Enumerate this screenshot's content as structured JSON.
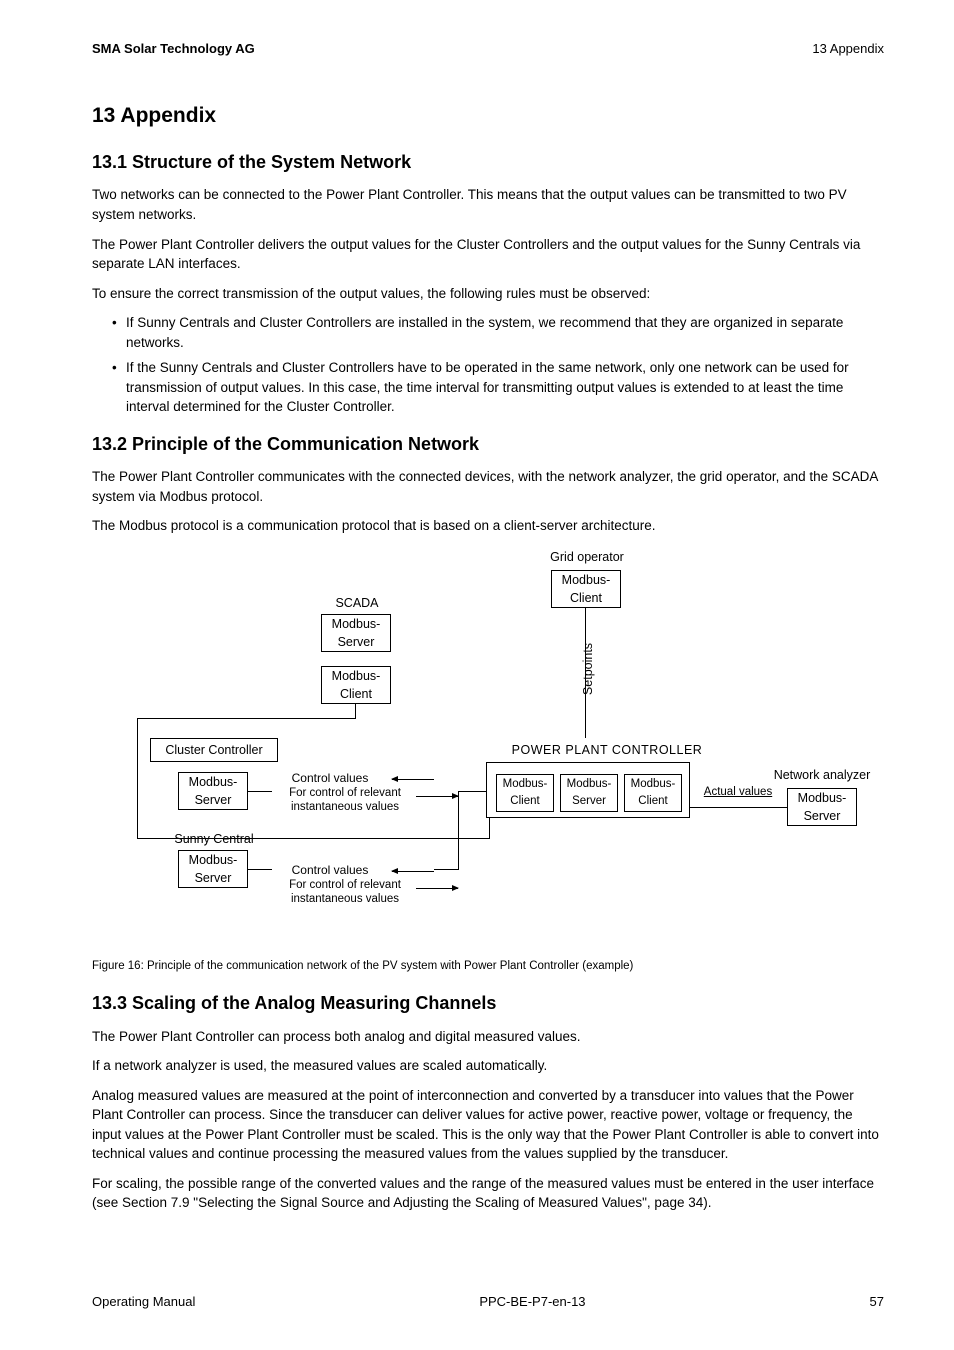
{
  "header": {
    "company": "SMA Solar Technology AG",
    "section_ref": "13  Appendix"
  },
  "h1": "13 Appendix",
  "s1": {
    "title": "13.1 Structure of the System Network",
    "p1": "Two networks can be connected to the Power Plant Controller. This means that the output values can be transmitted to two PV system networks.",
    "p2": "The Power Plant Controller delivers the output values for the Cluster Controllers and the output values for the Sunny Centrals via separate LAN interfaces.",
    "p3": "To ensure the correct transmission of the output values, the following rules must be observed:",
    "li1": "If Sunny Centrals and Cluster Controllers are installed in the system, we recommend that they are organized in separate networks.",
    "li2": "If the Sunny Centrals and Cluster Controllers have to be operated in the same network, only one network can be used for transmission of output values. In this case, the time interval for transmitting output values is extended to at least the time interval determined for the Cluster Controller."
  },
  "s2": {
    "title": "13.2 Principle of the Communication Network",
    "p1": "The Power Plant Controller communicates with the connected devices, with the network analyzer, the grid operator, and the SCADA system via Modbus protocol.",
    "p2": "The Modbus protocol is a communication protocol that is based on a client-server architecture.",
    "caption": "Figure 16:  Principle of the communication network of the PV system with Power Plant Controller (example)"
  },
  "diagram": {
    "grid_operator": "Grid operator",
    "modbus_client": "Modbus-\nClient",
    "modbus_server": "Modbus-\nServer",
    "scada": "SCADA",
    "setpoints": "Setpoints",
    "cluster_controller": "Cluster Controller",
    "sunny_central": "Sunny Central",
    "control_values": "Control values",
    "for_control": "For control of relevant instantaneous values",
    "ppc": "POWER PLANT CONTROLLER",
    "network_analyzer": "Network analyzer",
    "actual_values": "Actual values"
  },
  "s3": {
    "title": "13.3 Scaling of the Analog Measuring Channels",
    "p1": "The Power Plant Controller can process both analog and digital measured values.",
    "p2": "If a network analyzer is used, the measured values are scaled automatically.",
    "p3": "Analog measured values are measured at the point of interconnection and converted by a transducer into values that the Power Plant Controller can process. Since the transducer can deliver values for active power, reactive power, voltage or frequency, the input values at the Power Plant Controller must be scaled. This is the only way that the Power Plant Controller is able to convert into technical values and continue processing the measured values from the values supplied by the transducer.",
    "p4": "For scaling, the possible range of the converted values and the range of the measured values must be entered in the user interface (see Section 7.9 \"Selecting the Signal Source and Adjusting the Scaling of Measured Values\", page 34)."
  },
  "footer": {
    "left": "Operating Manual",
    "center": "PPC-BE-P7-en-13",
    "right": "57"
  }
}
